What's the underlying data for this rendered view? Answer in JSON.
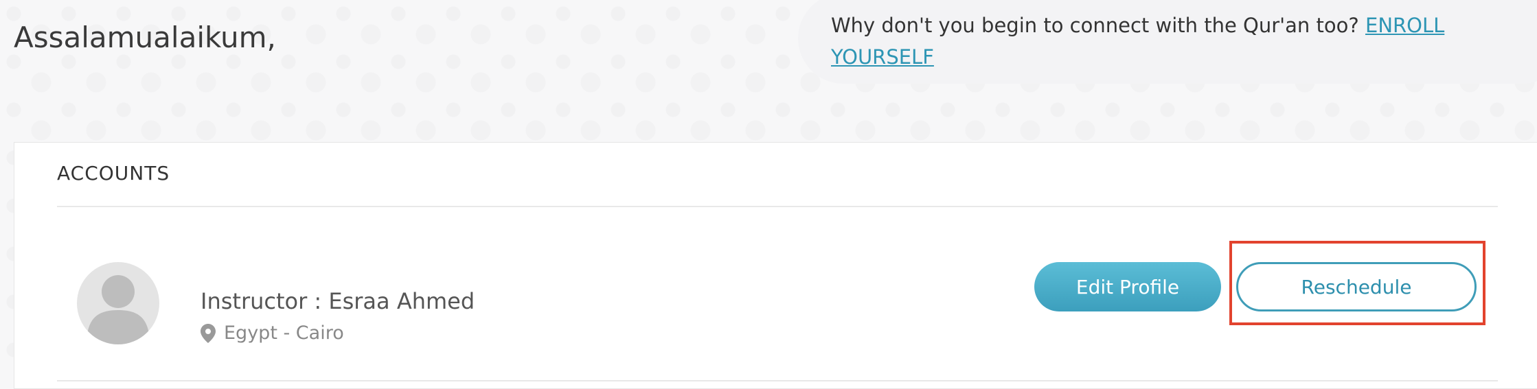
{
  "greeting": "Assalamualaikum,",
  "banner": {
    "text": "Why don't you begin to connect with the Qur'an too? ",
    "link_label": "ENROLL YOURSELF"
  },
  "accounts": {
    "title": "ACCOUNTS",
    "instructor_label": "Instructor : Esraa Ahmed",
    "location": "Egypt - Cairo",
    "edit_profile_label": "Edit Profile",
    "reschedule_label": "Reschedule"
  },
  "colors": {
    "accent": "#3c9fbd",
    "link": "#2d95b4",
    "highlight": "#e2432e"
  },
  "icons": {
    "avatar": "user-silhouette-icon",
    "location": "map-pin-icon"
  }
}
